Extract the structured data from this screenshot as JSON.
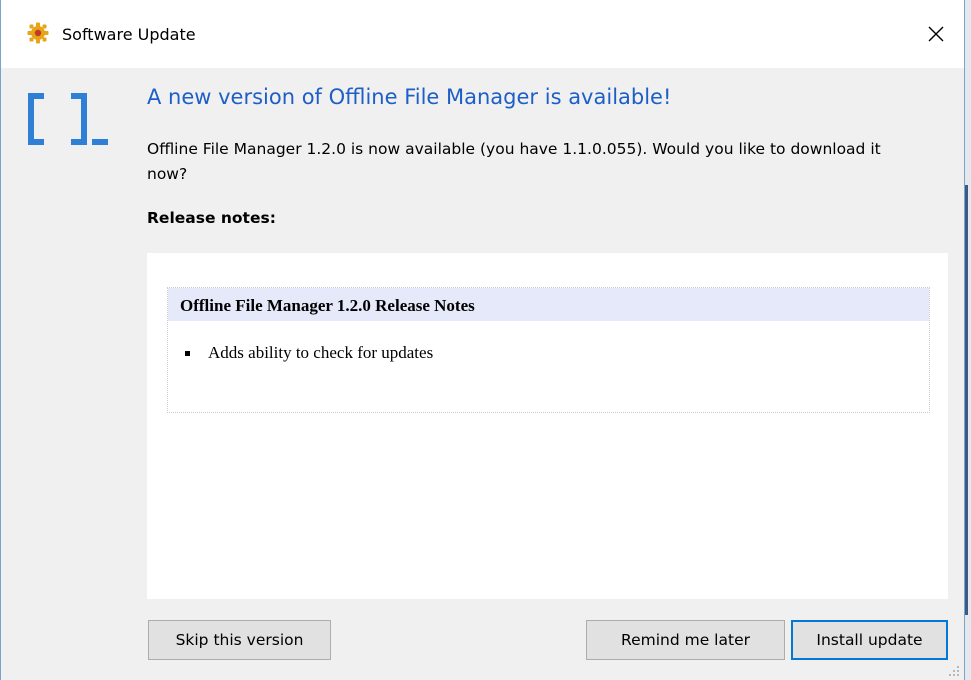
{
  "window": {
    "title": "Software Update",
    "close_glyph": "✕"
  },
  "icons": {
    "title_icon": "gear-icon",
    "app_logo": "bracket-logo-icon",
    "close": "close-icon"
  },
  "header": {
    "headline": "A new version of Offline File Manager is available!",
    "description": "Offline File Manager 1.2.0 is now available (you have 1.1.0.055). Would you like to download it now?"
  },
  "release_notes": {
    "label": "Release notes:",
    "document_title": "Offline File Manager 1.2.0 Release Notes",
    "items": [
      "Adds ability to check for updates"
    ]
  },
  "buttons": {
    "skip": "Skip this version",
    "remind": "Remind me later",
    "install": "Install update"
  },
  "colors": {
    "headline": "#1d5fc6",
    "logo": "#2f7fd6",
    "title_icon": "#e8a317",
    "notes_header_bg": "#e5e9fa",
    "default_button_border": "#0078d7"
  }
}
